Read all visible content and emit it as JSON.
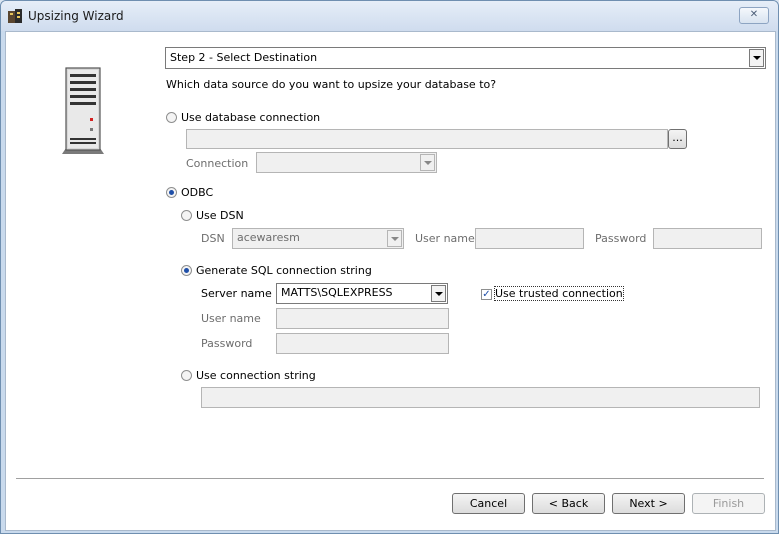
{
  "window": {
    "title": "Upsizing Wizard",
    "close_glyph": "✕"
  },
  "step": {
    "value": "Step 2 - Select Destination"
  },
  "question": "Which data source do you want to upsize your database to?",
  "options": {
    "use_db_connection": {
      "label": "Use database connection",
      "selected": false,
      "path_value": "",
      "browse_label": "...",
      "connection_label": "Connection",
      "connection_value": ""
    },
    "odbc": {
      "label": "ODBC",
      "selected": true,
      "use_dsn": {
        "label": "Use DSN",
        "selected": false,
        "dsn_label": "DSN",
        "dsn_value": "acewaresm",
        "user_label": "User name",
        "user_value": "",
        "password_label": "Password",
        "password_value": ""
      },
      "generate_sql": {
        "label": "Generate SQL connection string",
        "selected": true,
        "server_label": "Server name",
        "server_value": "MATTS\\SQLEXPRESS",
        "trusted_label": "Use trusted connection",
        "trusted_checked": true,
        "user_label": "User name",
        "user_value": "",
        "password_label": "Password",
        "password_value": ""
      },
      "use_conn_string": {
        "label": "Use connection string",
        "selected": false,
        "value": ""
      }
    }
  },
  "buttons": {
    "cancel": "Cancel",
    "back": "< Back",
    "next": "Next >",
    "finish": "Finish"
  }
}
